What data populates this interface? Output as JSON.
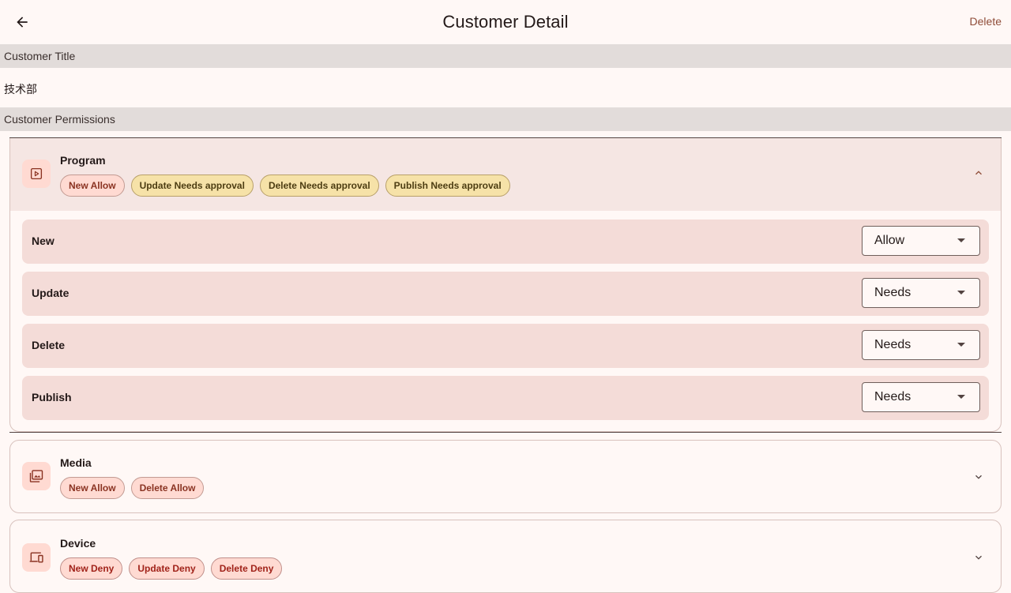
{
  "appbar": {
    "title": "Customer Detail",
    "delete_label": "Delete",
    "back_icon": "arrow-back-icon"
  },
  "customer_title": {
    "header": "Customer Title",
    "value": "技术部"
  },
  "permissions": {
    "header": "Customer Permissions",
    "groups": [
      {
        "name": "Program",
        "icon": "play-box-icon",
        "expanded": true,
        "chips": [
          {
            "label": "New Allow",
            "kind": "allow"
          },
          {
            "label": "Update Needs approval",
            "kind": "needs"
          },
          {
            "label": "Delete Needs approval",
            "kind": "needs"
          },
          {
            "label": "Publish Needs approval",
            "kind": "needs"
          }
        ],
        "rows": [
          {
            "label": "New",
            "value": "Allow"
          },
          {
            "label": "Update",
            "value": "Needs"
          },
          {
            "label": "Delete",
            "value": "Needs"
          },
          {
            "label": "Publish",
            "value": "Needs"
          }
        ]
      },
      {
        "name": "Media",
        "icon": "photo-library-icon",
        "expanded": false,
        "chips": [
          {
            "label": "New Allow",
            "kind": "allow"
          },
          {
            "label": "Delete Allow",
            "kind": "allow"
          }
        ]
      },
      {
        "name": "Device",
        "icon": "devices-icon",
        "expanded": false,
        "chips": [
          {
            "label": "New Deny",
            "kind": "deny"
          },
          {
            "label": "Update Deny",
            "kind": "deny"
          },
          {
            "label": "Delete Deny",
            "kind": "deny"
          }
        ]
      }
    ]
  },
  "colors": {
    "background": "#fff8f6",
    "accent": "#8f4c38",
    "section_header": "#e2dcda",
    "allow_chip": "#ffdad2",
    "needs_chip": "#f6e2a8"
  }
}
